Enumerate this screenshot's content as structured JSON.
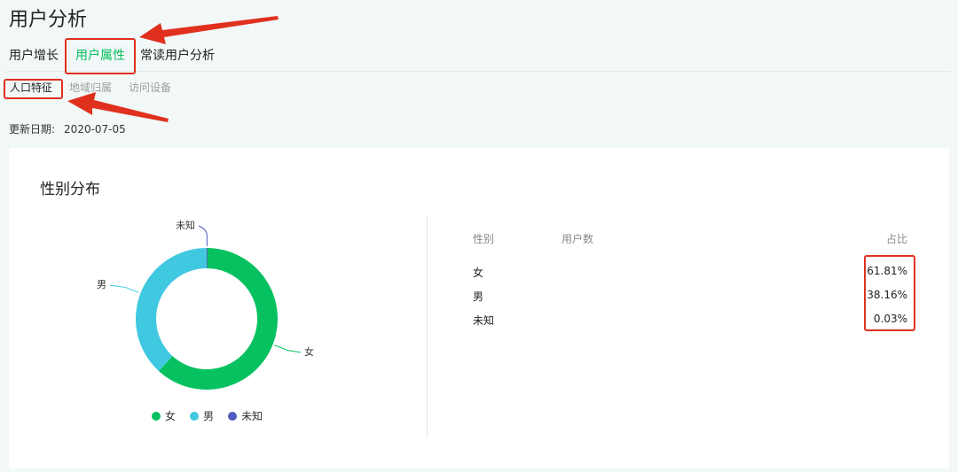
{
  "page_title": "用户分析",
  "tabs": [
    {
      "label": "用户增长"
    },
    {
      "label": "用户属性"
    },
    {
      "label": "常读用户分析"
    }
  ],
  "subtabs": [
    {
      "label": "人口特征"
    },
    {
      "label": "地域归属"
    },
    {
      "label": "访问设备"
    }
  ],
  "update": {
    "label": "更新日期:",
    "value": "2020-07-05"
  },
  "card": {
    "title": "性别分布",
    "table": {
      "headers": [
        "性别",
        "用户数",
        "占比"
      ],
      "rows": [
        {
          "gender": "女",
          "share": "61.81%"
        },
        {
          "gender": "男",
          "share": "38.16%"
        },
        {
          "gender": "未知",
          "share": "0.03%"
        }
      ]
    }
  },
  "colors": {
    "female": "#07c160",
    "male": "#40c8e0",
    "unknown": "#4e5cbf",
    "accent": "#07c160",
    "annotation": "#e0301e"
  },
  "chart_data": {
    "type": "pie",
    "title": "性别分布",
    "labels": [
      "女",
      "男",
      "未知"
    ],
    "values": [
      61.81,
      38.16,
      0.03
    ],
    "legend": [
      "女",
      "男",
      "未知"
    ],
    "legend_position": "bottom"
  }
}
